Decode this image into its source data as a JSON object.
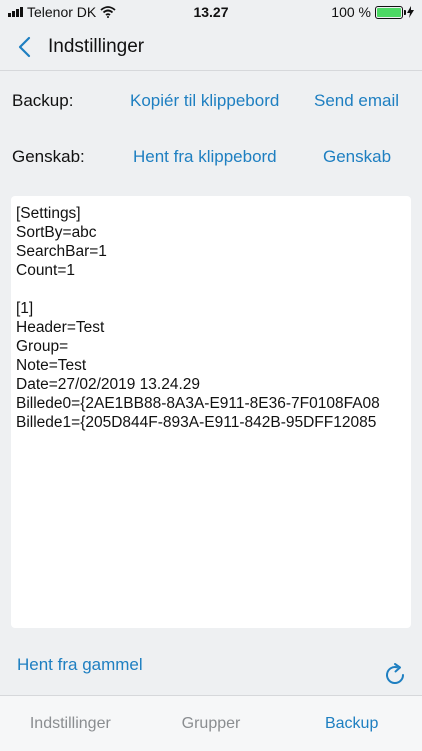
{
  "status": {
    "carrier": "Telenor DK",
    "time": "13.27",
    "battery": "100 %",
    "battery_level": 1.0
  },
  "nav": {
    "title": "Indstillinger"
  },
  "backup_row": {
    "label": "Backup:",
    "copy_label": "Kopiér til klippebord",
    "email_label": "Send email"
  },
  "restore_row": {
    "label": "Genskab:",
    "fetch_label": "Hent fra klippebord",
    "restore_label": "Genskab"
  },
  "settings_text": [
    "[Settings]",
    "SortBy=abc",
    "SearchBar=1",
    "Count=1",
    "",
    "[1]",
    "Header=Test",
    "Group=",
    "Note=Test",
    "Date=27/02/2019 13.24.29",
    "Billede0={2AE1BB88-8A3A-E911-8E36-7F0108FA08",
    "Billede1={205D844F-893A-E911-842B-95DFF12085"
  ],
  "footer": {
    "old_label": "Hent fra gammel"
  },
  "tabs": [
    {
      "label": "Indstillinger",
      "active": false
    },
    {
      "label": "Grupper",
      "active": false
    },
    {
      "label": "Backup",
      "active": true
    }
  ],
  "colors": {
    "accent": "#1e7fc1",
    "background": "#eef0f2"
  }
}
